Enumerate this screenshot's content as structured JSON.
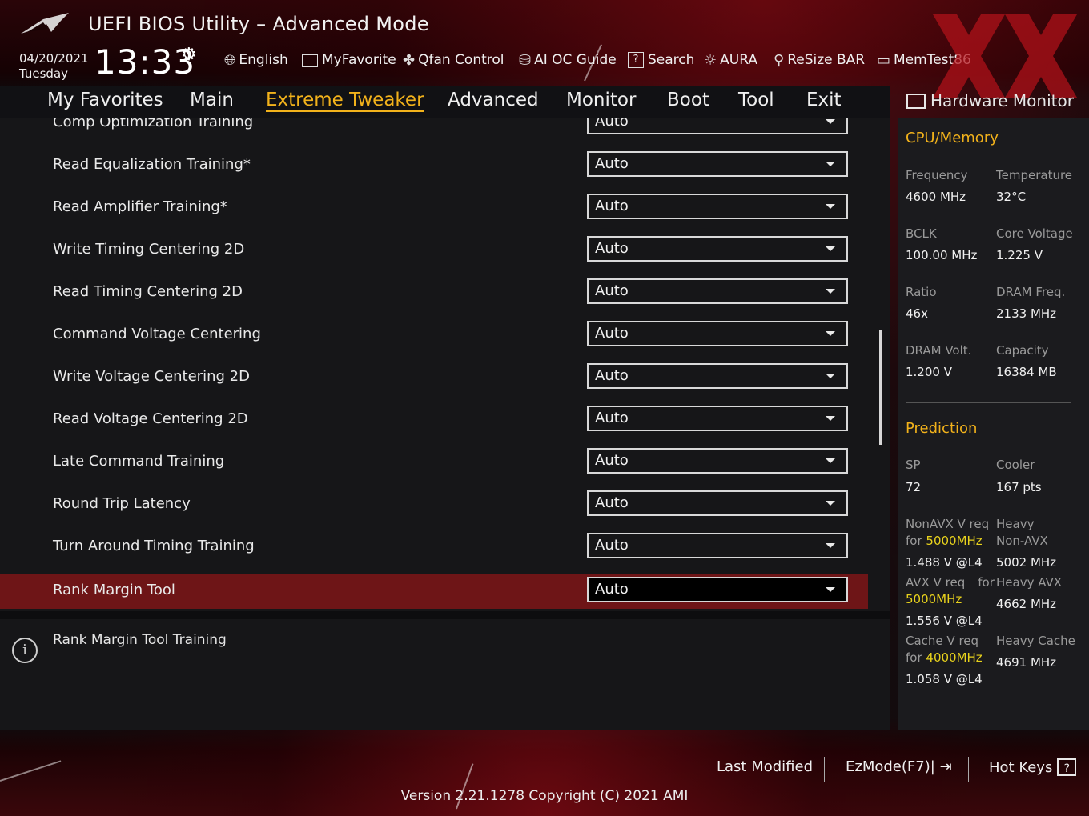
{
  "header": {
    "app_title": "UEFI BIOS Utility – Advanced Mode",
    "date": "04/20/2021",
    "weekday": "Tuesday",
    "time": "13:33",
    "tools": [
      {
        "label": "English",
        "icon": "globe-icon"
      },
      {
        "label": "MyFavorite",
        "icon": "favorite-icon"
      },
      {
        "label": "Qfan Control",
        "icon": "fan-icon"
      },
      {
        "label": "AI OC Guide",
        "icon": "ai-chip-icon"
      },
      {
        "label": "Search",
        "icon": "question-icon"
      },
      {
        "label": "AURA",
        "icon": "aura-icon"
      },
      {
        "label": "ReSize BAR",
        "icon": "resize-bar-icon"
      },
      {
        "label": "MemTest86",
        "icon": "memory-icon"
      }
    ]
  },
  "menu": {
    "items": [
      "My Favorites",
      "Main",
      "Extreme Tweaker",
      "Advanced",
      "Monitor",
      "Boot",
      "Tool",
      "Exit"
    ],
    "active": "Extreme Tweaker"
  },
  "settings": [
    {
      "label": "Comp Optimization Training",
      "value": "Auto"
    },
    {
      "label": "Read Equalization Training*",
      "value": "Auto"
    },
    {
      "label": "Read Amplifier Training*",
      "value": "Auto"
    },
    {
      "label": "Write Timing Centering 2D",
      "value": "Auto"
    },
    {
      "label": "Read Timing Centering 2D",
      "value": "Auto"
    },
    {
      "label": "Command Voltage Centering",
      "value": "Auto"
    },
    {
      "label": "Write Voltage Centering 2D",
      "value": "Auto"
    },
    {
      "label": "Read Voltage Centering 2D",
      "value": "Auto"
    },
    {
      "label": "Late Command Training",
      "value": "Auto"
    },
    {
      "label": "Round Trip Latency",
      "value": "Auto"
    },
    {
      "label": "Turn Around Timing Training",
      "value": "Auto"
    },
    {
      "label": "Rank Margin Tool",
      "value": "Auto"
    }
  ],
  "selected_setting": "Rank Margin Tool",
  "info": {
    "text": "Rank Margin Tool Training"
  },
  "hw_monitor": {
    "title": "Hardware Monitor",
    "cpu_memory": {
      "section": "CPU/Memory",
      "frequency_label": "Frequency",
      "frequency": "4600 MHz",
      "temperature_label": "Temperature",
      "temperature": "32°C",
      "bclk_label": "BCLK",
      "bclk": "100.00 MHz",
      "core_voltage_label": "Core Voltage",
      "core_voltage": "1.225 V",
      "ratio_label": "Ratio",
      "ratio": "46x",
      "dram_freq_label": "DRAM Freq.",
      "dram_freq": "2133 MHz",
      "dram_volt_label": "DRAM Volt.",
      "dram_volt": "1.200 V",
      "capacity_label": "Capacity",
      "capacity": "16384 MB"
    },
    "prediction": {
      "section": "Prediction",
      "sp_label": "SP",
      "sp": "72",
      "cooler_label": "Cooler",
      "cooler": "167 pts",
      "nonavx_label_1": "NonAVX V req",
      "nonavx_label_for": "for ",
      "nonavx_freq": "5000MHz",
      "nonavx_value": "1.488 V @L4",
      "heavy_nonavx_label_1": "Heavy",
      "heavy_nonavx_label_2": "Non-AVX",
      "heavy_nonavx_value": "5002 MHz",
      "avx_label": "AVX V req",
      "avx_for": "for",
      "avx_freq": "5000MHz",
      "avx_value": "1.556 V @L4",
      "heavy_avx_label": "Heavy AVX",
      "heavy_avx_value": "4662 MHz",
      "cache_label": "Cache V req",
      "cache_for": "for ",
      "cache_freq": "4000MHz",
      "cache_value": "1.058 V @L4",
      "heavy_cache_label": "Heavy Cache",
      "heavy_cache_value": "4691 MHz"
    }
  },
  "footer": {
    "last_modified": "Last Modified",
    "ezmode": "EzMode(F7)|",
    "hotkeys": "Hot Keys",
    "hotkeys_icon": "?",
    "version": "Version 2.21.1278 Copyright (C) 2021 AMI"
  },
  "colors": {
    "accent": "#f2b21b",
    "selected_row": "#6e1517",
    "highlight_freq": "#e8d21c"
  }
}
